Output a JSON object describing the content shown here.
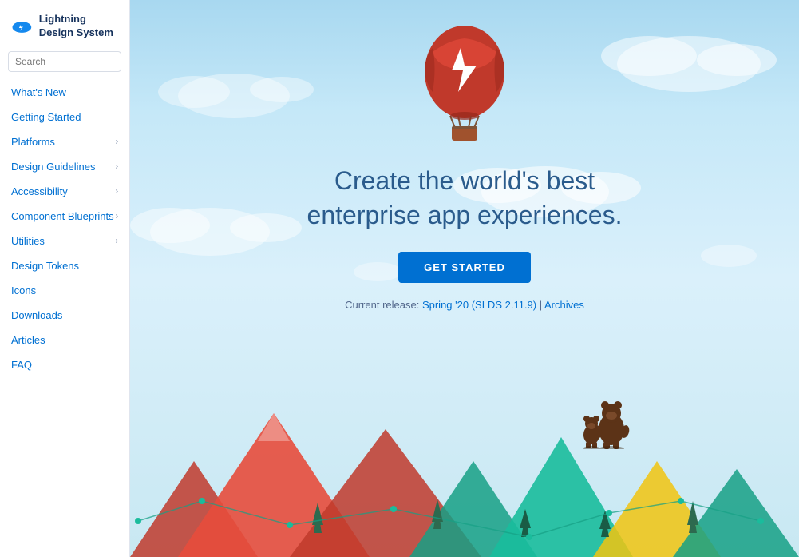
{
  "sidebar": {
    "logo_alt": "Salesforce",
    "title": "Lightning Design System",
    "search_placeholder": "Search",
    "nav_items": [
      {
        "label": "What's New",
        "has_arrow": false,
        "href": "#"
      },
      {
        "label": "Getting Started",
        "has_arrow": false,
        "href": "#"
      },
      {
        "label": "Platforms",
        "has_arrow": true,
        "href": "#"
      },
      {
        "label": "Design Guidelines",
        "has_arrow": true,
        "href": "#"
      },
      {
        "label": "Accessibility",
        "has_arrow": true,
        "href": "#"
      },
      {
        "label": "Component Blueprints",
        "has_arrow": true,
        "href": "#"
      },
      {
        "label": "Utilities",
        "has_arrow": true,
        "href": "#"
      },
      {
        "label": "Design Tokens",
        "has_arrow": false,
        "href": "#"
      },
      {
        "label": "Icons",
        "has_arrow": false,
        "href": "#"
      },
      {
        "label": "Downloads",
        "has_arrow": false,
        "href": "#"
      },
      {
        "label": "Articles",
        "has_arrow": false,
        "href": "#"
      },
      {
        "label": "FAQ",
        "has_arrow": false,
        "href": "#"
      }
    ]
  },
  "hero": {
    "headline_line1": "Create the world's best",
    "headline_line2": "enterprise app experiences.",
    "cta_label": "GET STARTED",
    "release_prefix": "Current release: ",
    "release_link_label": "Spring '20 (SLDS 2.11.9)",
    "separator": " | ",
    "archives_label": "Archives"
  }
}
